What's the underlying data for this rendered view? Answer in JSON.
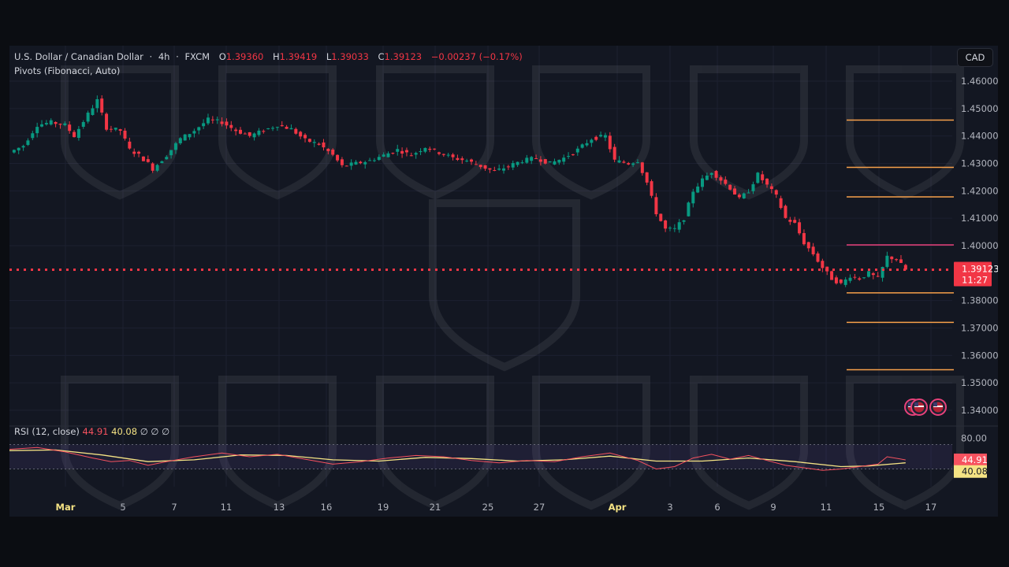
{
  "header": {
    "symbol": "U.S. Dollar / Canadian Dollar",
    "sep1": "·",
    "interval": "4h",
    "sep2": "·",
    "exchange": "FXCM",
    "o_label": "O",
    "o_value": "1.39360",
    "h_label": "H",
    "h_value": "1.39419",
    "l_label": "L",
    "l_value": "1.39033",
    "c_label": "C",
    "c_value": "1.39123",
    "change": "−0.00237 (−0.17%)",
    "indicator": "Pivots (Fibonacci, Auto)"
  },
  "currency_button": "CAD",
  "rsi_legend": {
    "name": "RSI (12, close)",
    "rsi_value": "44.91",
    "ma_value": "40.08",
    "extra1": "∅",
    "extra2": "∅",
    "extra3": "∅"
  },
  "colors": {
    "up": "#089981",
    "down": "#f23645",
    "pivot_orange": "#f7a04a",
    "pivot_pink": "#e8417a",
    "last_price": "#f23645",
    "rsi_line": "#f7525f",
    "rsi_ma": "#f5e384",
    "rsi_band": "#7e57c2"
  },
  "chart_data": {
    "type": "candlestick",
    "y_axis": {
      "ticks": [
        "1.46000",
        "1.45000",
        "1.44000",
        "1.43000",
        "1.42000",
        "1.41000",
        "1.40000",
        "1.38000",
        "1.37000",
        "1.36000",
        "1.35000",
        "1.34000"
      ],
      "tick_values": [
        1.46,
        1.45,
        1.44,
        1.43,
        1.42,
        1.41,
        1.4,
        1.38,
        1.37,
        1.36,
        1.35,
        1.34
      ],
      "range": [
        1.34,
        1.46
      ]
    },
    "x_axis": {
      "ticks": [
        "Mar",
        "5",
        "7",
        "11",
        "13",
        "16",
        "19",
        "21",
        "25",
        "27",
        "Apr",
        "3",
        "6",
        "9",
        "11",
        "15",
        "17"
      ],
      "bold": [
        "Mar",
        "Apr"
      ]
    },
    "last_price": {
      "value": 1.39123,
      "label": "1.39123",
      "countdown": "11:27"
    },
    "pivot_levels": [
      {
        "value": 1.4458,
        "color": "orange"
      },
      {
        "value": 1.42855,
        "color": "orange"
      },
      {
        "value": 1.4178,
        "color": "orange"
      },
      {
        "value": 1.4003,
        "color": "pink"
      },
      {
        "value": 1.3828,
        "color": "orange"
      },
      {
        "value": 1.37205,
        "color": "orange"
      },
      {
        "value": 1.3548,
        "color": "orange"
      }
    ],
    "close_path": [
      [
        0,
        1.434
      ],
      [
        3,
        1.4365
      ],
      [
        6,
        1.444
      ],
      [
        9,
        1.445
      ],
      [
        12,
        1.444
      ],
      [
        14,
        1.44
      ],
      [
        17,
        1.448
      ],
      [
        19,
        1.453
      ],
      [
        21,
        1.443
      ],
      [
        24,
        1.442
      ],
      [
        26,
        1.435
      ],
      [
        28,
        1.433
      ],
      [
        30,
        1.43
      ],
      [
        31,
        1.428
      ],
      [
        34,
        1.433
      ],
      [
        37,
        1.439
      ],
      [
        40,
        1.442
      ],
      [
        43,
        1.446
      ],
      [
        46,
        1.445
      ],
      [
        49,
        1.442
      ],
      [
        52,
        1.44
      ],
      [
        55,
        1.442
      ],
      [
        58,
        1.444
      ],
      [
        61,
        1.4425
      ],
      [
        64,
        1.4385
      ],
      [
        67,
        1.437
      ],
      [
        70,
        1.433
      ],
      [
        72,
        1.429
      ],
      [
        75,
        1.43
      ],
      [
        78,
        1.431
      ],
      [
        81,
        1.433
      ],
      [
        84,
        1.435
      ],
      [
        87,
        1.433
      ],
      [
        90,
        1.436
      ],
      [
        93,
        1.434
      ],
      [
        96,
        1.432
      ],
      [
        99,
        1.431
      ],
      [
        102,
        1.429
      ],
      [
        105,
        1.427
      ],
      [
        108,
        1.429
      ],
      [
        111,
        1.431
      ],
      [
        114,
        1.432
      ],
      [
        117,
        1.43
      ],
      [
        120,
        1.432
      ],
      [
        123,
        1.435
      ],
      [
        126,
        1.439
      ],
      [
        129,
        1.44
      ],
      [
        131,
        1.431
      ],
      [
        134,
        1.43
      ],
      [
        136,
        1.431
      ],
      [
        138,
        1.423
      ],
      [
        140,
        1.412
      ],
      [
        142,
        1.406
      ],
      [
        144,
        1.406
      ],
      [
        146,
        1.41
      ],
      [
        148,
        1.42
      ],
      [
        150,
        1.424
      ],
      [
        152,
        1.427
      ],
      [
        154,
        1.424
      ],
      [
        156,
        1.421
      ],
      [
        158,
        1.417
      ],
      [
        160,
        1.42
      ],
      [
        162,
        1.426
      ],
      [
        164,
        1.422
      ],
      [
        166,
        1.418
      ],
      [
        168,
        1.41
      ],
      [
        170,
        1.408
      ],
      [
        172,
        1.401
      ],
      [
        174,
        1.397
      ],
      [
        176,
        1.392
      ],
      [
        178,
        1.388
      ],
      [
        180,
        1.386
      ],
      [
        182,
        1.389
      ],
      [
        184,
        1.388
      ],
      [
        186,
        1.39
      ],
      [
        188,
        1.388
      ],
      [
        190,
        1.396
      ],
      [
        192,
        1.395
      ],
      [
        194,
        1.3912
      ]
    ],
    "rsi": {
      "ticks": [
        "80.00"
      ],
      "upper_band": 70,
      "lower_band": 30,
      "range": [
        0,
        100
      ],
      "rsi_path": [
        [
          0,
          62
        ],
        [
          6,
          65
        ],
        [
          12,
          58
        ],
        [
          18,
          48
        ],
        [
          22,
          42
        ],
        [
          26,
          44
        ],
        [
          30,
          36
        ],
        [
          34,
          42
        ],
        [
          40,
          50
        ],
        [
          46,
          56
        ],
        [
          52,
          50
        ],
        [
          58,
          54
        ],
        [
          64,
          46
        ],
        [
          70,
          38
        ],
        [
          76,
          42
        ],
        [
          82,
          48
        ],
        [
          88,
          52
        ],
        [
          94,
          50
        ],
        [
          100,
          44
        ],
        [
          106,
          40
        ],
        [
          112,
          44
        ],
        [
          118,
          42
        ],
        [
          124,
          50
        ],
        [
          130,
          56
        ],
        [
          136,
          44
        ],
        [
          140,
          30
        ],
        [
          144,
          34
        ],
        [
          148,
          48
        ],
        [
          152,
          54
        ],
        [
          156,
          46
        ],
        [
          160,
          52
        ],
        [
          164,
          44
        ],
        [
          168,
          36
        ],
        [
          172,
          32
        ],
        [
          176,
          28
        ],
        [
          180,
          30
        ],
        [
          184,
          34
        ],
        [
          188,
          38
        ],
        [
          190,
          50
        ],
        [
          194,
          44.91
        ]
      ],
      "ma_path": [
        [
          0,
          60
        ],
        [
          10,
          61
        ],
        [
          20,
          53
        ],
        [
          30,
          42
        ],
        [
          40,
          45
        ],
        [
          50,
          53
        ],
        [
          60,
          52
        ],
        [
          70,
          45
        ],
        [
          80,
          43
        ],
        [
          90,
          49
        ],
        [
          100,
          47
        ],
        [
          110,
          43
        ],
        [
          120,
          45
        ],
        [
          130,
          51
        ],
        [
          140,
          43
        ],
        [
          150,
          43
        ],
        [
          160,
          48
        ],
        [
          170,
          42
        ],
        [
          180,
          34
        ],
        [
          186,
          35
        ],
        [
          194,
          40.08
        ]
      ]
    }
  }
}
